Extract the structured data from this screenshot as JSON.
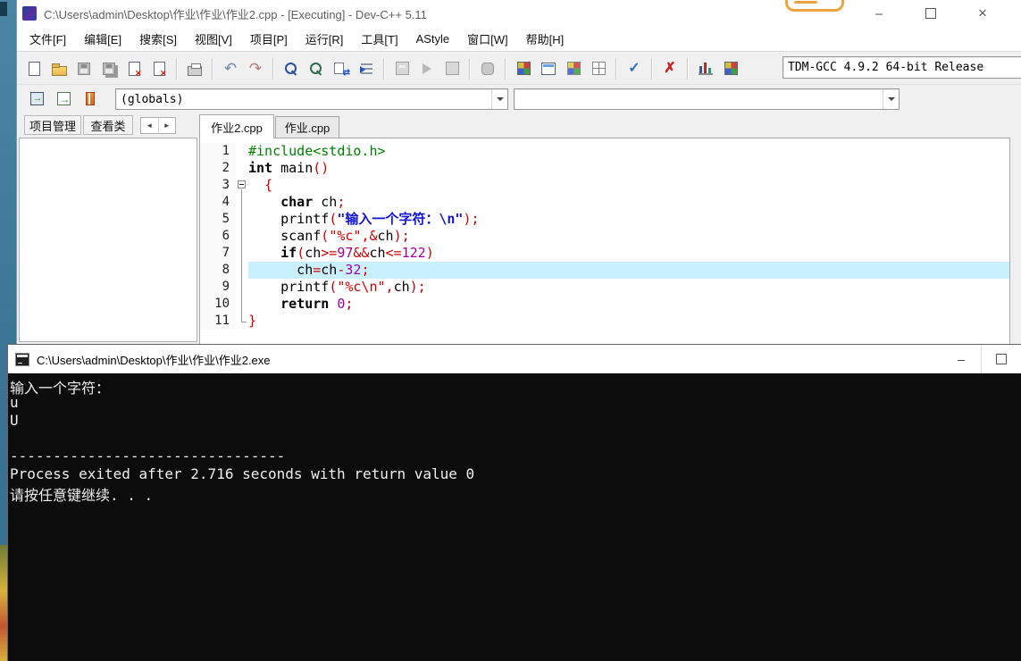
{
  "window": {
    "title": "C:\\Users\\admin\\Desktop\\作业\\作业\\作业2.cpp - [Executing] - Dev-C++ 5.11",
    "minimize": "–",
    "close": "×"
  },
  "menu": [
    "文件[F]",
    "编辑[E]",
    "搜索[S]",
    "视图[V]",
    "项目[P]",
    "运行[R]",
    "工具[T]",
    "AStyle",
    "窗口[W]",
    "帮助[H]"
  ],
  "toolbar": {
    "compiler": "TDM-GCC 4.9.2 64-bit Release"
  },
  "symbol_bar": {
    "scope": "(globals)",
    "member": ""
  },
  "panel_tabs": [
    "项目管理",
    "查看类"
  ],
  "panel_nav": {
    "left": "◄",
    "right": "►"
  },
  "editor_tabs": [
    "作业2.cpp",
    "作业.cpp"
  ],
  "glyphs": {
    "undo": "↶",
    "redo": "↷",
    "check": "✓",
    "clean": "✗"
  },
  "code": {
    "lines": [
      {
        "n": 1,
        "fold": null,
        "hl": false,
        "tokens": [
          {
            "t": "#include<stdio.h>",
            "c": "pre"
          }
        ]
      },
      {
        "n": 2,
        "fold": null,
        "hl": false,
        "tokens": [
          {
            "t": "int",
            "c": "kw"
          },
          {
            "t": " main",
            "c": "pl"
          },
          {
            "t": "()",
            "c": "sym"
          }
        ]
      },
      {
        "n": 3,
        "fold": "start",
        "hl": false,
        "tokens": [
          {
            "t": "  ",
            "c": "pl"
          },
          {
            "t": "{",
            "c": "sym"
          }
        ]
      },
      {
        "n": 4,
        "fold": "mid",
        "hl": false,
        "tokens": [
          {
            "t": "    ",
            "c": "pl"
          },
          {
            "t": "char",
            "c": "kw"
          },
          {
            "t": " ch",
            "c": "pl"
          },
          {
            "t": ";",
            "c": "sym"
          }
        ]
      },
      {
        "n": 5,
        "fold": "mid",
        "hl": false,
        "tokens": [
          {
            "t": "    printf",
            "c": "pl"
          },
          {
            "t": "(",
            "c": "sym"
          },
          {
            "t": "\"输入一个字符：\\n\"",
            "c": "cstr"
          },
          {
            "t": ");",
            "c": "sym"
          }
        ]
      },
      {
        "n": 6,
        "fold": "mid",
        "hl": false,
        "tokens": [
          {
            "t": "    scanf",
            "c": "pl"
          },
          {
            "t": "(",
            "c": "sym"
          },
          {
            "t": "\"%c\"",
            "c": "str"
          },
          {
            "t": ",&",
            "c": "sym"
          },
          {
            "t": "ch",
            "c": "pl"
          },
          {
            "t": ");",
            "c": "sym"
          }
        ]
      },
      {
        "n": 7,
        "fold": "mid",
        "hl": false,
        "tokens": [
          {
            "t": "    ",
            "c": "pl"
          },
          {
            "t": "if",
            "c": "kw"
          },
          {
            "t": "(",
            "c": "sym"
          },
          {
            "t": "ch",
            "c": "pl"
          },
          {
            "t": ">=",
            "c": "sym"
          },
          {
            "t": "97",
            "c": "num"
          },
          {
            "t": "&&",
            "c": "sym"
          },
          {
            "t": "ch",
            "c": "pl"
          },
          {
            "t": "<=",
            "c": "sym"
          },
          {
            "t": "122",
            "c": "num"
          },
          {
            "t": ")",
            "c": "sym"
          }
        ]
      },
      {
        "n": 8,
        "fold": "mid",
        "hl": true,
        "tokens": [
          {
            "t": "      ch",
            "c": "pl"
          },
          {
            "t": "=",
            "c": "sym"
          },
          {
            "t": "ch",
            "c": "pl"
          },
          {
            "t": "-",
            "c": "sym"
          },
          {
            "t": "32",
            "c": "num"
          },
          {
            "t": ";",
            "c": "sym"
          }
        ]
      },
      {
        "n": 9,
        "fold": "mid",
        "hl": false,
        "tokens": [
          {
            "t": "    printf",
            "c": "pl"
          },
          {
            "t": "(",
            "c": "sym"
          },
          {
            "t": "\"%c\\n\"",
            "c": "str"
          },
          {
            "t": ",",
            "c": "sym"
          },
          {
            "t": "ch",
            "c": "pl"
          },
          {
            "t": ");",
            "c": "sym"
          }
        ]
      },
      {
        "n": 10,
        "fold": "mid",
        "hl": false,
        "tokens": [
          {
            "t": "    ",
            "c": "pl"
          },
          {
            "t": "return",
            "c": "kw"
          },
          {
            "t": " ",
            "c": "pl"
          },
          {
            "t": "0",
            "c": "num"
          },
          {
            "t": ";",
            "c": "sym"
          }
        ]
      },
      {
        "n": 11,
        "fold": "end",
        "hl": false,
        "tokens": [
          {
            "t": "}",
            "c": "sym"
          }
        ]
      }
    ]
  },
  "console": {
    "title": "C:\\Users\\admin\\Desktop\\作业\\作业\\作业2.exe",
    "minimize": "–",
    "lines": [
      "输入一个字符：",
      "u",
      "U",
      "",
      "--------------------------------",
      "Process exited after 2.716 seconds with return value 0",
      "请按任意键继续. . ."
    ]
  }
}
